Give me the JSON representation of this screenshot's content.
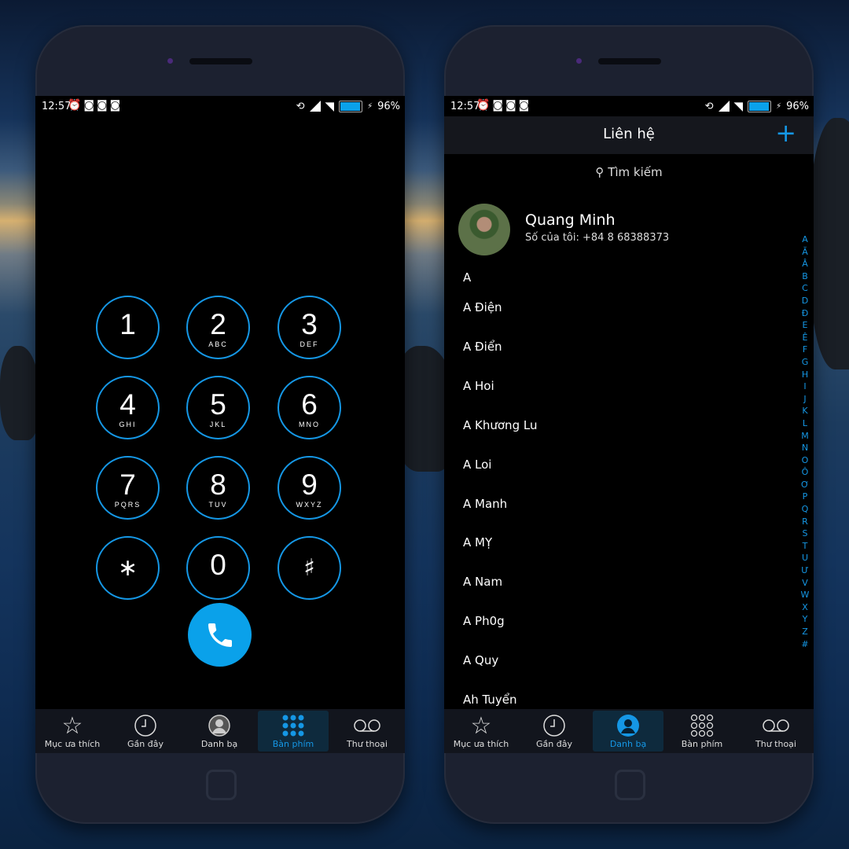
{
  "dialer": {
    "status": {
      "time": "12:57",
      "battery": "96%"
    },
    "keys": [
      {
        "digit": "1",
        "letters": ""
      },
      {
        "digit": "2",
        "letters": "ABC"
      },
      {
        "digit": "3",
        "letters": "DEF"
      },
      {
        "digit": "4",
        "letters": "GHI"
      },
      {
        "digit": "5",
        "letters": "JKL"
      },
      {
        "digit": "6",
        "letters": "MNO"
      },
      {
        "digit": "7",
        "letters": "PQRS"
      },
      {
        "digit": "8",
        "letters": "TUV"
      },
      {
        "digit": "9",
        "letters": "WXYZ"
      },
      {
        "digit": "∗",
        "letters": ""
      },
      {
        "digit": "0",
        "letters": ""
      },
      {
        "digit": "♯",
        "letters": ""
      }
    ],
    "tabs": [
      "Mục ưa thích",
      "Gần đây",
      "Danh bạ",
      "Bàn phím",
      "Thư thoại"
    ],
    "active_tab": "Bàn phím"
  },
  "contacts": {
    "status": {
      "time": "12:57",
      "battery": "96%"
    },
    "title": "Liên hệ",
    "search_placeholder": "Tìm kiếm",
    "me": {
      "name": "Quang Minh",
      "number_label": "Số của tôi: +84 8 68388373"
    },
    "section": "A",
    "list": [
      "A Điện",
      "A Điển",
      "A Hoi",
      "A Khương Lu",
      "A Loi",
      "A Manh",
      "A MỴ",
      "A Nam",
      "A Ph0g",
      "A Quy",
      "Ah Tuyển"
    ],
    "alphabet": [
      "A",
      "Ă",
      "Â",
      "B",
      "C",
      "D",
      "Đ",
      "E",
      "Ê",
      "F",
      "G",
      "H",
      "I",
      "J",
      "K",
      "L",
      "M",
      "N",
      "O",
      "Ô",
      "Ơ",
      "P",
      "Q",
      "R",
      "S",
      "T",
      "U",
      "Ư",
      "V",
      "W",
      "X",
      "Y",
      "Z",
      "#"
    ],
    "tabs": [
      "Mục ưa thích",
      "Gần đây",
      "Danh bạ",
      "Bàn phím",
      "Thư thoại"
    ],
    "active_tab": "Danh bạ"
  },
  "colors": {
    "accent": "#1597e5",
    "call_button": "#0aa1ea",
    "screen_bg": "#000000"
  }
}
